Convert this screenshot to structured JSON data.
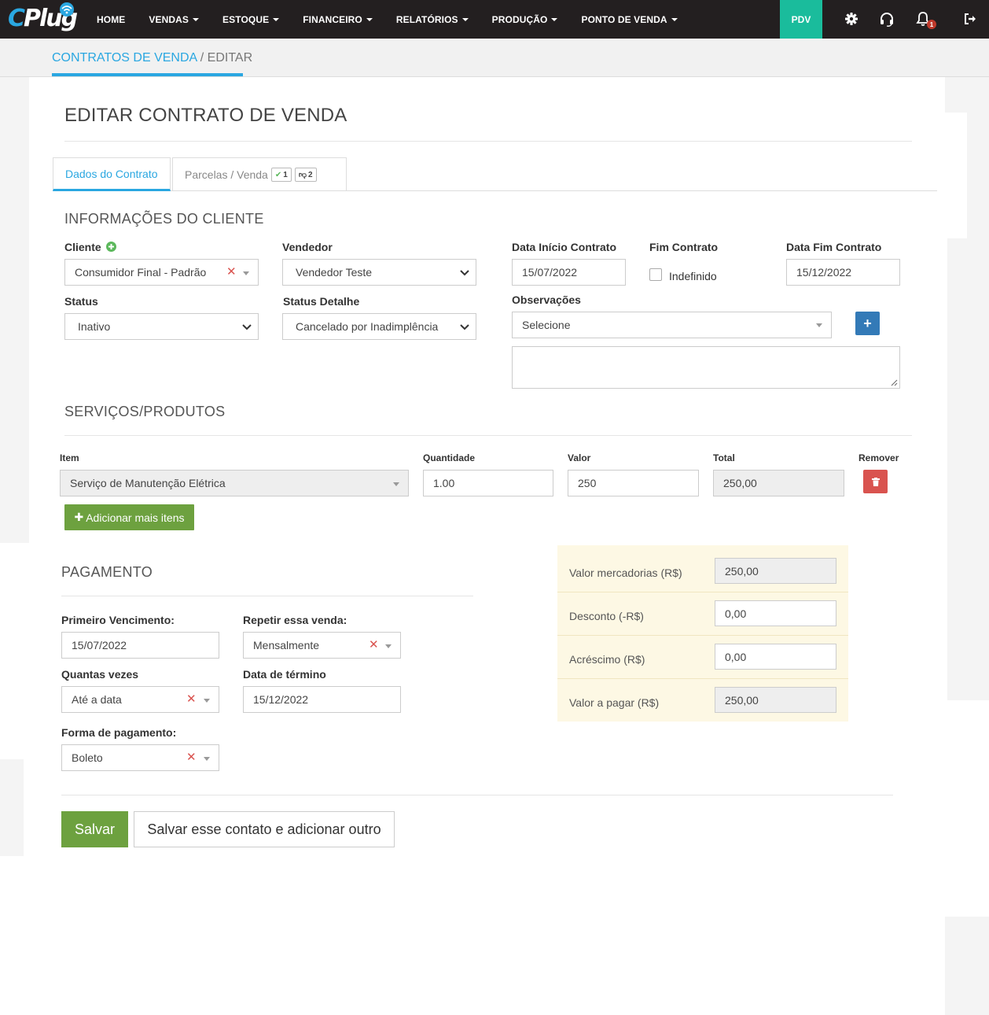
{
  "brand": {
    "logo_c": "C",
    "logo_rest": "Plug",
    "accent": "#2aa7e1"
  },
  "nav": {
    "items": [
      {
        "label": "HOME",
        "caret": false
      },
      {
        "label": "VENDAS",
        "caret": true
      },
      {
        "label": "ESTOQUE",
        "caret": true
      },
      {
        "label": "FINANCEIRO",
        "caret": true
      },
      {
        "label": "RELATÓRIOS",
        "caret": true
      },
      {
        "label": "PRODUÇÃO",
        "caret": true
      },
      {
        "label": "PONTO DE VENDA",
        "caret": true
      }
    ],
    "pdv_label": "PDV",
    "notification_count": "1",
    "icons": [
      "gear-icon",
      "headset-icon",
      "bell-icon",
      "logout-icon"
    ]
  },
  "breadcrumb": {
    "parent": "CONTRATOS DE VENDA",
    "separator": " / ",
    "current": "EDITAR"
  },
  "page_title": "EDITAR CONTRATO DE VENDA",
  "tabs": {
    "dados": "Dados do Contrato",
    "parcelas": "Parcelas / Venda",
    "badge_ok": "1",
    "badge_down": "2"
  },
  "cliente_section": {
    "title": "INFORMAÇÕES DO CLIENTE",
    "cliente_label": "Cliente",
    "cliente_value": "Consumidor Final - Padrão",
    "vendedor_label": "Vendedor",
    "vendedor_value": "Vendedor Teste",
    "data_inicio_label": "Data Início Contrato",
    "data_inicio_value": "15/07/2022",
    "fim_label": "Fim Contrato",
    "indefinido_label": "Indefinido",
    "data_fim_label": "Data Fim Contrato",
    "data_fim_value": "15/12/2022",
    "status_label": "Status",
    "status_value": "Inativo",
    "status_detalhe_label": "Status Detalhe",
    "status_detalhe_value": "Cancelado por Inadimplência",
    "observacoes_label": "Observações",
    "observacoes_placeholder": "Selecione",
    "add_label": "+"
  },
  "servicos": {
    "title": "SERVIÇOS/PRODUTOS",
    "col_item": "Item",
    "col_qtd": "Quantidade",
    "col_valor": "Valor",
    "col_total": "Total",
    "col_remover": "Remover",
    "row": {
      "item": "Serviço de Manutenção Elétrica",
      "qtd": "1.00",
      "valor": "250",
      "total": "250,00"
    },
    "add_more": "Adicionar mais itens"
  },
  "pagamento": {
    "title": "PAGAMENTO",
    "primeiro_label": "Primeiro Vencimento:",
    "primeiro_value": "15/07/2022",
    "repetir_label": "Repetir essa venda:",
    "repetir_value": "Mensalmente",
    "quantas_label": "Quantas vezes",
    "quantas_value": "Até a data",
    "termino_label": "Data de término",
    "termino_value": "15/12/2022",
    "forma_label": "Forma de pagamento:",
    "forma_value": "Boleto"
  },
  "totais": {
    "mercadorias_label": "Valor mercadorias (R$)",
    "mercadorias_value": "250,00",
    "desconto_label": "Desconto (-R$)",
    "desconto_value": "0,00",
    "acrescimo_label": "Acréscimo (R$)",
    "acrescimo_value": "0,00",
    "pagar_label": "Valor a pagar (R$)",
    "pagar_value": "250,00"
  },
  "actions": {
    "save": "Salvar",
    "save_add": "Salvar esse contato e adicionar outro"
  }
}
